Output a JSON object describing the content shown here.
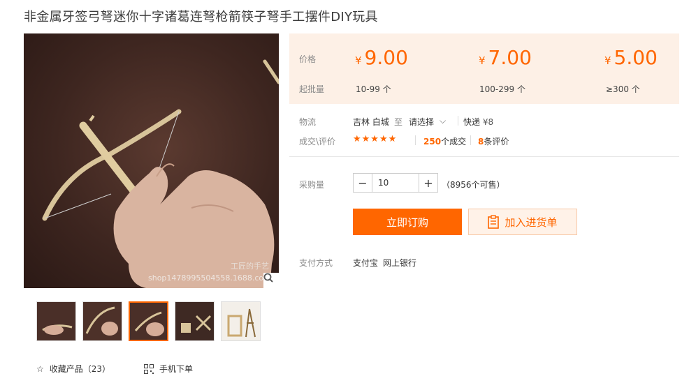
{
  "product": {
    "title": "非金属牙签弓弩迷你十字诸葛连弩枪箭筷子弩手工摆件DIY玩具"
  },
  "gallery": {
    "watermark_shop": "工匠的手艺",
    "watermark_url": "shop1478995504558.1688.com",
    "thumb_count": 5,
    "active_thumb": 3
  },
  "price_table": {
    "price_label": "价格",
    "min_qty_label": "起批量",
    "currency": "¥",
    "tiers": [
      {
        "price": "9.00",
        "qty": "10-99 个"
      },
      {
        "price": "7.00",
        "qty": "100-299 个"
      },
      {
        "price": "5.00",
        "qty": "≥300 个"
      }
    ]
  },
  "logistics": {
    "label": "物流",
    "origin": "吉林 白城",
    "to": "至",
    "select": "请选择",
    "express": "快递",
    "fee": "¥8"
  },
  "deals": {
    "label": "成交\\评价",
    "stars": "★★★★★",
    "count": "250",
    "count_suffix": "个成交",
    "reviews": "8",
    "reviews_suffix": "条评价"
  },
  "purchase": {
    "label": "采购量",
    "minus": "−",
    "quantity": "10",
    "plus": "+",
    "available": "（8956个可售）",
    "buy_label": "立即订购",
    "cart_label": "加入进货单"
  },
  "payment": {
    "label": "支付方式",
    "methods": [
      "支付宝",
      "网上银行"
    ]
  },
  "links": {
    "favorite": "收藏产品（23）",
    "mobile": "手机下单"
  },
  "colors": {
    "accent": "#ff6600",
    "panel": "#fdf0e6"
  }
}
